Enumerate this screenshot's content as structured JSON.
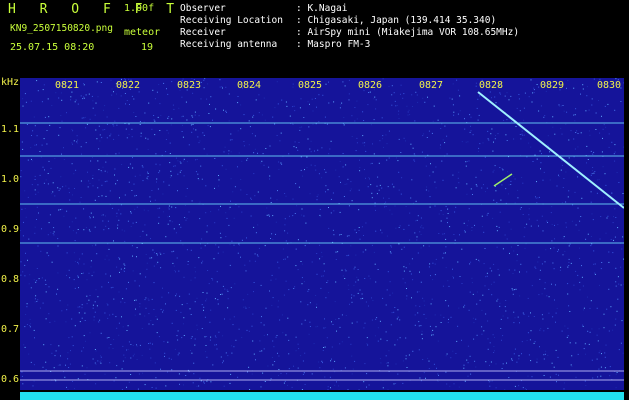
{
  "header": {
    "app_title": "H R O F F T",
    "version": "1.00f",
    "file_name": "KN9_2507150820.png",
    "mode": "meteor",
    "datetime": "25.07.15 08:20",
    "count": "19"
  },
  "info": [
    {
      "label": "Observer",
      "value": ": K.Nagai"
    },
    {
      "label": "Receiving Location",
      "value": ": Chigasaki, Japan (139.414 35.340)"
    },
    {
      "label": "Receiver",
      "value": ": AirSpy mini (Miakejima VOR 108.65MHz)"
    },
    {
      "label": "Receiving antenna",
      "value": ": Maspro FM-3"
    }
  ],
  "axis": {
    "y_unit": "kHz",
    "y_ticks": [
      "1.1",
      "1.0",
      "0.9",
      "0.8",
      "0.7",
      "0.6"
    ],
    "x_ticks": [
      "0821",
      "0822",
      "0823",
      "0824",
      "0825",
      "0826",
      "0827",
      "0828",
      "0829",
      "0830"
    ]
  },
  "colors": {
    "background": "#15149a",
    "trace": "#7fe8ff",
    "label": "#f2f24a",
    "header_text": "#c9ff3a"
  }
}
